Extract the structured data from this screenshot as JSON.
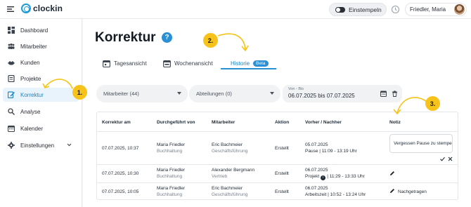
{
  "app": {
    "logo_text": "clockin",
    "clockin_label": "Einstempeln",
    "user_name": "Friedler, Maria",
    "accent": "#2a8fd3",
    "marker_color": "#f7c31b"
  },
  "sidebar": {
    "items": [
      {
        "label": "Dashboard",
        "icon": "dashboard-icon"
      },
      {
        "label": "Mitarbeiter",
        "icon": "employees-icon"
      },
      {
        "label": "Kunden",
        "icon": "customers-icon"
      },
      {
        "label": "Projekte",
        "icon": "projects-icon"
      },
      {
        "label": "Korrektur",
        "icon": "correction-icon",
        "active": true
      },
      {
        "label": "Analyse",
        "icon": "analysis-icon"
      },
      {
        "label": "Kalender",
        "icon": "calendar-icon"
      },
      {
        "label": "Einstellungen",
        "icon": "settings-icon"
      }
    ]
  },
  "page": {
    "title": "Korrektur",
    "help": "?"
  },
  "tabs": [
    {
      "label": "Tagesansicht"
    },
    {
      "label": "Wochenansicht"
    },
    {
      "label": "Historie",
      "badge": "Beta",
      "active": true
    }
  ],
  "filters": {
    "employees": "Mitarbeiter (44)",
    "departments": "Abteilungen (0)",
    "date_caption": "Von - Bis",
    "date_value": "06.07.2025 bis 07.07.2025"
  },
  "table": {
    "headers": [
      "Korrektur am",
      "Durchgeführt von",
      "Mitarbeiter",
      "Aktion",
      "Vorher / Nachher",
      "Notiz"
    ],
    "rows": [
      {
        "date": "07.07.2025, 10:37",
        "by_name": "Maria Friedler",
        "by_dept": "Buchhaltung",
        "emp_name": "Eric Bachmeier",
        "emp_dept": "Geschäftsführung",
        "action": "Erstellt",
        "change_date": "05.07.2025",
        "change_detail": "Pause | 11:09 - 13:19 Uhr",
        "note": "Vergessen Pause zu stempeln"
      },
      {
        "date": "07.07.2025, 10:30",
        "by_name": "Maria Friedler",
        "by_dept": "Buchhaltung",
        "emp_name": "Alexander Bergmann",
        "emp_dept": "Vertrieb",
        "action": "Erstellt",
        "change_date": "06.07.2025",
        "change_prefix": "Projekt",
        "change_detail": "| 11:29 - 13:33 Uhr",
        "note": ""
      },
      {
        "date": "07.07.2025, 10:05",
        "by_name": "Maria Friedler",
        "by_dept": "Buchhaltung",
        "emp_name": "Eric Bachmeier",
        "emp_dept": "Geschäftsführung",
        "action": "Erstellt",
        "change_date": "06.07.2025",
        "change_detail": "Arbeitszeit | 10:52 - 13:24 Uhr",
        "note": "Nachgetragen"
      }
    ]
  },
  "markers": [
    "1.",
    "2.",
    "3."
  ]
}
